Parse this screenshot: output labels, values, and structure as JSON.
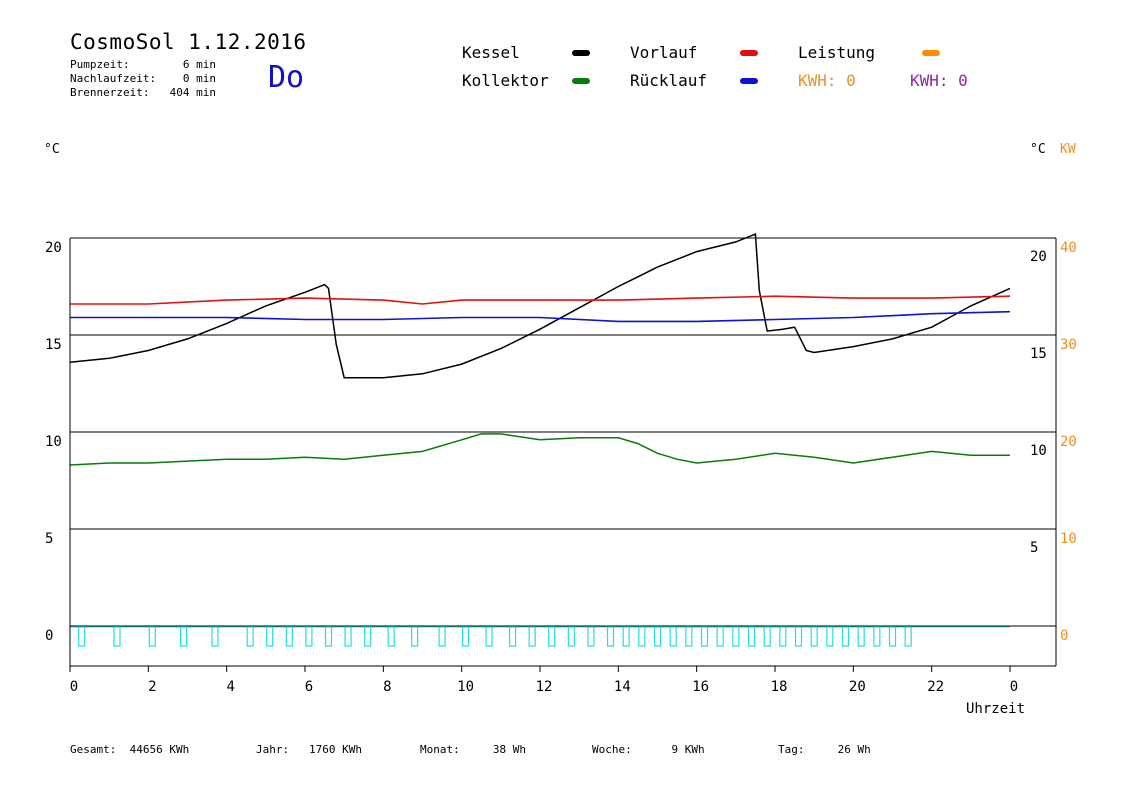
{
  "header": {
    "title": "CosmoSol 1.12.2016",
    "day": "Do",
    "stats": [
      {
        "label": "Pumpzeit:",
        "value": "6 min"
      },
      {
        "label": "Nachlaufzeit:",
        "value": "0 min"
      },
      {
        "label": "Brennerzeit:",
        "value": "404 min"
      }
    ]
  },
  "legend": {
    "kessel": "Kessel",
    "kollektor": "Kollektor",
    "vorlauf": "Vorlauf",
    "ruecklauf": "Rücklauf",
    "leistung": "Leistung",
    "kwh1": "KWH: 0",
    "kwh2": "KWH: 0"
  },
  "units": {
    "left": "°C",
    "right": "°C",
    "right_kw": "KW"
  },
  "footer": {
    "gesamt": "Gesamt:  44656 KWh",
    "jahr": "Jahr:   1760 KWh",
    "monat": "Monat:     38 Wh",
    "woche": "Woche:      9 KWh",
    "tag": "Tag:     26 Wh"
  },
  "colors": {
    "kessel": "#000000",
    "kollektor": "#0a7a0a",
    "vorlauf": "#e01010",
    "ruecklauf": "#1010d0",
    "leistung": "#ff8c00",
    "kwh2": "#8a2aa0",
    "pump": "#20e0e0",
    "axis_orange": "#ee9020"
  },
  "chart_data": {
    "type": "line",
    "xlabel": "Uhrzeit",
    "x_ticks": [
      "0",
      "2",
      "4",
      "6",
      "8",
      "10",
      "12",
      "14",
      "16",
      "18",
      "20",
      "22",
      "0"
    ],
    "xlim": [
      0,
      24
    ],
    "ylim": [
      0,
      20
    ],
    "y_ticks_left": [
      "20",
      "15",
      "10",
      "5",
      "0"
    ],
    "y_ticks_right_inner": [
      "20",
      "15",
      "10",
      "5"
    ],
    "y_ticks_right_kw": [
      "40",
      "30",
      "20",
      "10",
      "0"
    ],
    "grid": "horizontal",
    "series": [
      {
        "name": "Kessel",
        "color_key": "kessel",
        "x": [
          0,
          1,
          2,
          3,
          4,
          5,
          6,
          6.5,
          6.6,
          6.8,
          7,
          7.5,
          8,
          9,
          10,
          11,
          12,
          13,
          14,
          15,
          16,
          17,
          17.5,
          17.6,
          17.8,
          18.2,
          18.5,
          18.8,
          19,
          20,
          21,
          22,
          23,
          24
        ],
        "y": [
          13.6,
          13.8,
          14.2,
          14.8,
          15.6,
          16.5,
          17.2,
          17.6,
          17.4,
          14.5,
          12.8,
          12.8,
          12.8,
          13.0,
          13.5,
          14.3,
          15.3,
          16.4,
          17.5,
          18.5,
          19.3,
          19.8,
          20.2,
          17.3,
          15.2,
          15.3,
          15.4,
          14.2,
          14.1,
          14.4,
          14.8,
          15.4,
          16.5,
          17.4
        ]
      },
      {
        "name": "Vorlauf",
        "color_key": "vorlauf",
        "x": [
          0,
          2,
          4,
          6,
          8,
          9,
          10,
          12,
          14,
          16,
          18,
          20,
          22,
          24
        ],
        "y": [
          16.6,
          16.6,
          16.8,
          16.9,
          16.8,
          16.6,
          16.8,
          16.8,
          16.8,
          16.9,
          17.0,
          16.9,
          16.9,
          17.0
        ]
      },
      {
        "name": "Rücklauf",
        "color_key": "ruecklauf",
        "x": [
          0,
          2,
          4,
          6,
          8,
          10,
          12,
          14,
          16,
          18,
          20,
          22,
          24
        ],
        "y": [
          15.9,
          15.9,
          15.9,
          15.8,
          15.8,
          15.9,
          15.9,
          15.7,
          15.7,
          15.8,
          15.9,
          16.1,
          16.2
        ]
      },
      {
        "name": "Kollektor",
        "color_key": "kollektor",
        "x": [
          0,
          1,
          2,
          3,
          4,
          5,
          6,
          7,
          8,
          9,
          10,
          10.5,
          11,
          12,
          13,
          14,
          14.5,
          15,
          15.5,
          16,
          17,
          18,
          19,
          20,
          21,
          22,
          23,
          24
        ],
        "y": [
          8.3,
          8.4,
          8.4,
          8.5,
          8.6,
          8.6,
          8.7,
          8.6,
          8.8,
          9.0,
          9.6,
          9.9,
          9.9,
          9.6,
          9.7,
          9.7,
          9.4,
          8.9,
          8.6,
          8.4,
          8.6,
          8.9,
          8.7,
          8.4,
          8.7,
          9.0,
          8.8,
          8.8
        ]
      }
    ],
    "pump_pulses_hours": [
      0.3,
      1.2,
      2.1,
      2.9,
      3.7,
      4.6,
      5.1,
      5.6,
      6.1,
      6.6,
      7.1,
      7.6,
      8.2,
      8.8,
      9.5,
      10.1,
      10.7,
      11.3,
      11.8,
      12.3,
      12.8,
      13.3,
      13.8,
      14.2,
      14.6,
      15.0,
      15.4,
      15.8,
      16.2,
      16.6,
      17.0,
      17.4,
      17.8,
      18.2,
      18.6,
      19.0,
      19.4,
      19.8,
      20.2,
      20.6,
      21.0,
      21.4
    ]
  }
}
